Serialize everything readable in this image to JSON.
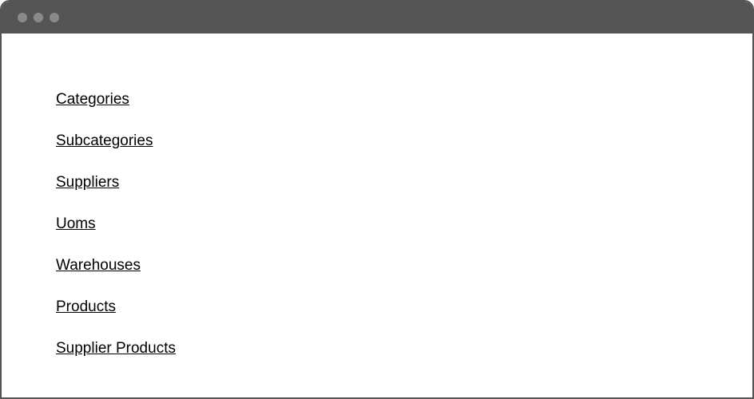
{
  "nav": {
    "items": [
      {
        "label": "Categories"
      },
      {
        "label": "Subcategories"
      },
      {
        "label": "Suppliers"
      },
      {
        "label": "Uoms"
      },
      {
        "label": "Warehouses"
      },
      {
        "label": "Products"
      },
      {
        "label": "Supplier Products"
      }
    ]
  }
}
